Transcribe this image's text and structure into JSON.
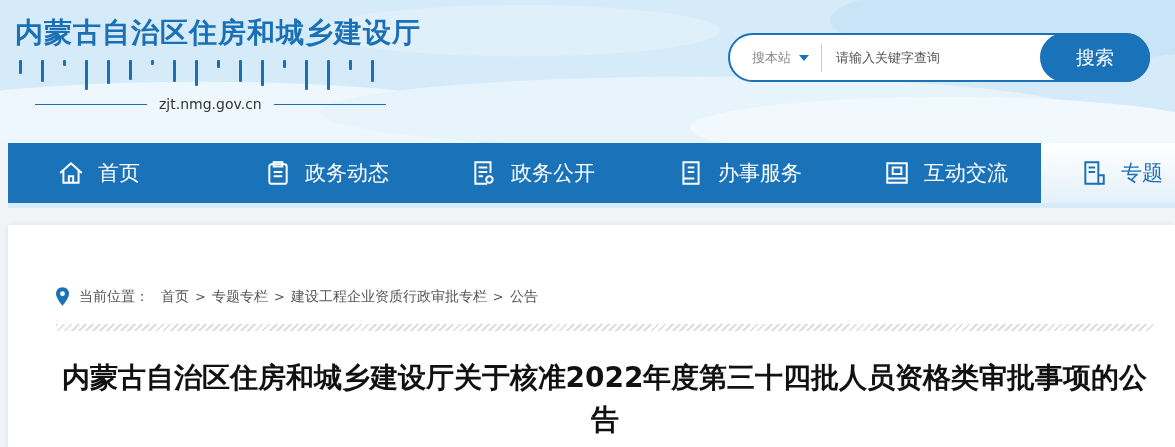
{
  "site": {
    "title": "内蒙古自治区住房和城乡建设厅",
    "domain": "zjt.nmg.gov.cn"
  },
  "search": {
    "scope": "搜本站",
    "placeholder": "请输入关键字查询",
    "button": "搜索"
  },
  "nav": [
    {
      "label": "首页",
      "kind": "home",
      "selected": false
    },
    {
      "label": "政务动态",
      "kind": "clipboard",
      "selected": false
    },
    {
      "label": "政务公开",
      "kind": "doc",
      "selected": false
    },
    {
      "label": "办事服务",
      "kind": "list",
      "selected": false
    },
    {
      "label": "互动交流",
      "kind": "card",
      "selected": false
    },
    {
      "label": "专题",
      "kind": "topic",
      "selected": true
    }
  ],
  "breadcrumb": {
    "label": "当前位置：",
    "items": [
      "首页",
      "专题专栏",
      "建设工程企业资质行政审批专栏",
      "公告"
    ],
    "separator": ">"
  },
  "article": {
    "title": "内蒙古自治区住房和城乡建设厅关于核准2022年度第三十四批人员资格类审批事项的公告"
  }
}
